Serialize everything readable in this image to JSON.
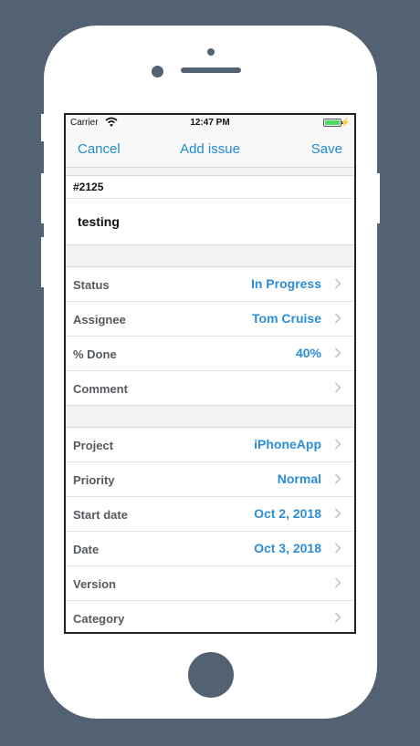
{
  "status_bar": {
    "carrier": "Carrier",
    "time": "12:47 PM"
  },
  "nav": {
    "cancel": "Cancel",
    "title": "Add issue",
    "save": "Save"
  },
  "issue": {
    "number": "#2125",
    "subject": "testing"
  },
  "group1": [
    {
      "label": "Status",
      "value": "In Progress"
    },
    {
      "label": "Assignee",
      "value": "Tom Cruise"
    },
    {
      "label": "% Done",
      "value": "40%"
    },
    {
      "label": "Comment",
      "value": ""
    }
  ],
  "group2": [
    {
      "label": "Project",
      "value": "iPhoneApp"
    },
    {
      "label": "Priority",
      "value": "Normal"
    },
    {
      "label": "Start date",
      "value": "Oct 2, 2018"
    },
    {
      "label": "Date",
      "value": "Oct 3, 2018"
    },
    {
      "label": "Version",
      "value": ""
    },
    {
      "label": "Category",
      "value": ""
    }
  ],
  "colors": {
    "accent": "#1f8ad1",
    "value": "#2c8ed6",
    "frame": "#536272"
  }
}
